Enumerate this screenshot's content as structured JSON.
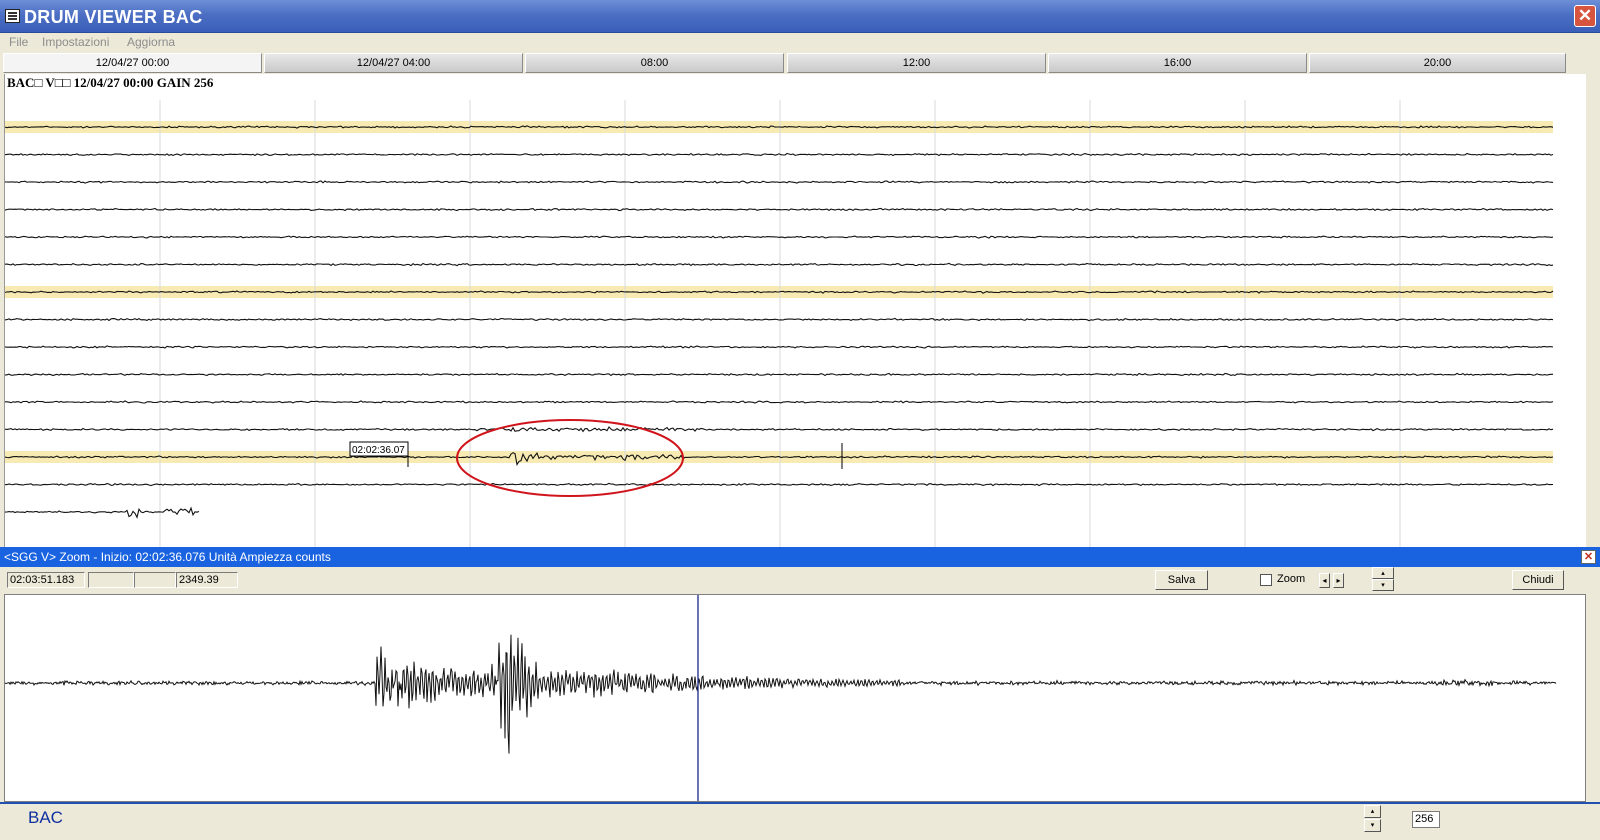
{
  "window": {
    "title": "DRUM VIEWER BAC",
    "close_label": "✕"
  },
  "menu": [
    "File",
    "Impostazioni",
    "Aggiorna"
  ],
  "time_header": [
    "12/04/27 00:00",
    "12/04/27 04:00",
    "08:00",
    "12:00",
    "16:00",
    "20:00"
  ],
  "drum": {
    "info_label": "BAC□ V□□ 12/04/27 00:00 GAIN  256",
    "marker_label": "02:02:36.07",
    "trace_count": 15,
    "highlighted_traces": [
      0,
      6,
      12
    ],
    "highlight_color": "#f7eab3",
    "event_circle_color": "#d0141c"
  },
  "zoom": {
    "title": "<SGG V> Zoom - Inizio: 02:02:36.076 Unità Ampiezza counts",
    "time_value": "02:03:51.183",
    "field2": "",
    "field3": "",
    "amplitude_value": "2349.39",
    "save_label": "Salva",
    "zoom_label": "Zoom",
    "zoom_checked": false,
    "close_label": "Chiudi",
    "cursor_color": "#1a2a8a"
  },
  "status": {
    "station": "BAC",
    "gain_value": "256"
  }
}
